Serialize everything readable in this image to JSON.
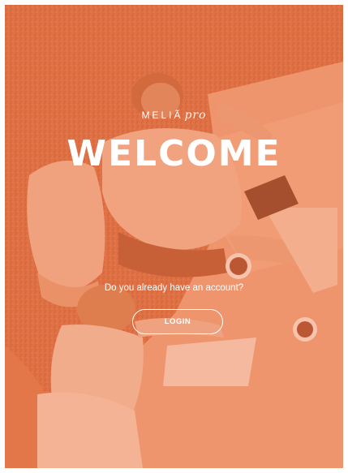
{
  "brand": {
    "name": "MELIÃ",
    "suffix": "pro"
  },
  "welcome": {
    "title": "WELCOME",
    "question": "Do you already have an account?",
    "login_label": "LOGIN"
  },
  "colors": {
    "overlay": "#e57a4c",
    "text": "#ffffff"
  }
}
